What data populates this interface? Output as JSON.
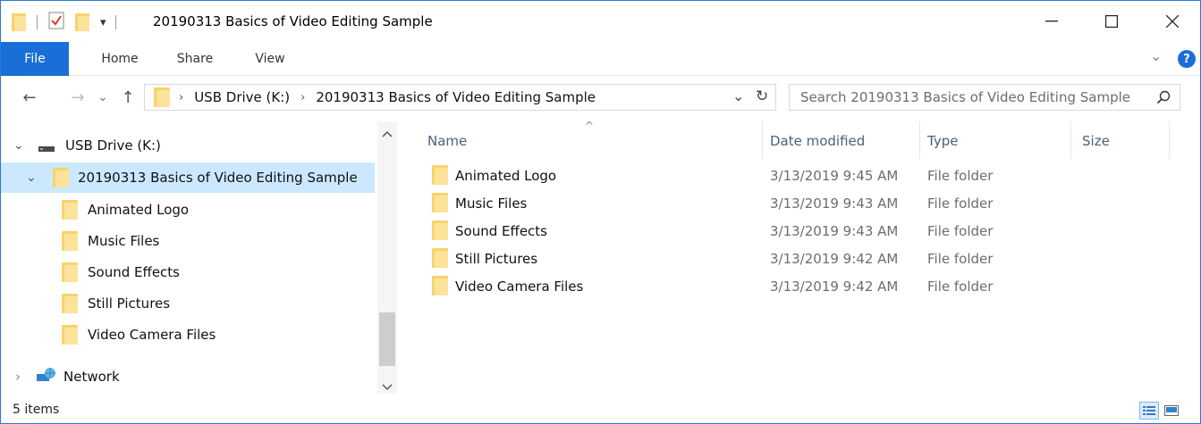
{
  "window": {
    "title": "20190313 Basics of Video Editing Sample",
    "quick_access_dropdown": "▾",
    "controls": {
      "minimize": "—",
      "maximize": "☐",
      "close": "✕"
    }
  },
  "ribbon": {
    "tabs": [
      "File",
      "Home",
      "Share",
      "View"
    ],
    "expand_chevron": "⌄",
    "help": "?"
  },
  "address": {
    "back": "←",
    "forward": "→",
    "recent": "⌄",
    "up": "↑",
    "crumbs": [
      "USB Drive (K:)",
      "20190313 Basics of Video Editing Sample"
    ],
    "separator": "›",
    "dropdown": "⌄",
    "refresh": "↻"
  },
  "search": {
    "placeholder": "Search 20190313 Basics of Video Editing Sample"
  },
  "nav_tree": {
    "drive": "USB Drive (K:)",
    "selected_folder": "20190313 Basics of Video Editing Sample",
    "children": [
      "Animated Logo",
      "Music Files",
      "Sound Effects",
      "Still Pictures",
      "Video Camera Files"
    ],
    "network": "Network",
    "expanded_chevron": "⌄",
    "collapsed_chevron": "›"
  },
  "columns": {
    "name": "Name",
    "date_modified": "Date modified",
    "type": "Type",
    "size": "Size",
    "sort_indicator": "^"
  },
  "files": [
    {
      "name": "Animated Logo",
      "date": "3/13/2019 9:45 AM",
      "type": "File folder"
    },
    {
      "name": "Music Files",
      "date": "3/13/2019 9:43 AM",
      "type": "File folder"
    },
    {
      "name": "Sound Effects",
      "date": "3/13/2019 9:43 AM",
      "type": "File folder"
    },
    {
      "name": "Still Pictures",
      "date": "3/13/2019 9:42 AM",
      "type": "File folder"
    },
    {
      "name": "Video Camera Files",
      "date": "3/13/2019 9:42 AM",
      "type": "File folder"
    }
  ],
  "status": {
    "item_count": "5 items"
  },
  "colors": {
    "accent": "#1a6ed8",
    "selection": "#cce8ff",
    "folder": "#f7d36b",
    "header_text": "#4c607a"
  }
}
